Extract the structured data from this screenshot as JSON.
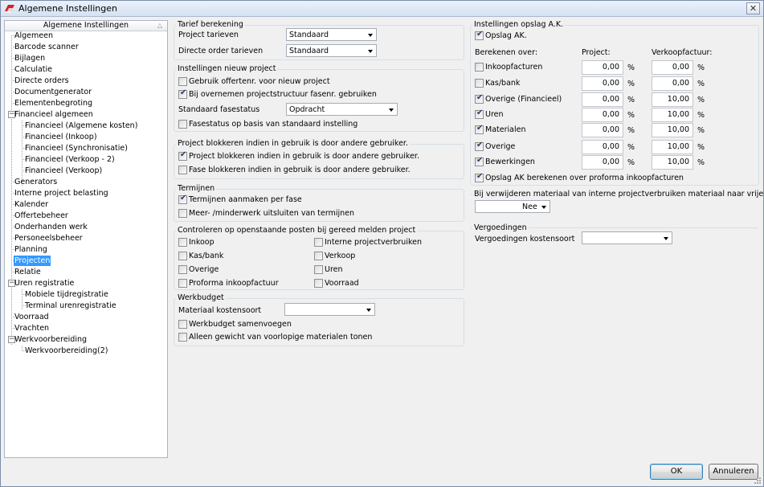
{
  "window": {
    "title": "Algemene Instellingen",
    "close_glyph": "✕",
    "app_icon": "brand-logo-icon"
  },
  "tree": {
    "header": "Algemene Instellingen",
    "sort_glyph": "△",
    "nodes": [
      {
        "label": "Algemeen"
      },
      {
        "label": "Barcode scanner"
      },
      {
        "label": "Bijlagen"
      },
      {
        "label": "Calculatie"
      },
      {
        "label": "Directe orders"
      },
      {
        "label": "Documentgenerator"
      },
      {
        "label": "Elementenbegroting"
      },
      {
        "label": "Financieel algemeen",
        "expander": "−"
      },
      {
        "label": "Financieel (Algemene kosten)"
      },
      {
        "label": "Financieel (Inkoop)"
      },
      {
        "label": "Financieel (Synchronisatie)"
      },
      {
        "label": "Financieel (Verkoop - 2)"
      },
      {
        "label": "Financieel (Verkoop)"
      },
      {
        "label": "Generators"
      },
      {
        "label": "Interne project belasting"
      },
      {
        "label": "Kalender"
      },
      {
        "label": "Offertebeheer"
      },
      {
        "label": "Onderhanden werk"
      },
      {
        "label": "Personeelsbeheer"
      },
      {
        "label": "Planning"
      },
      {
        "label": "Projecten",
        "selected": true
      },
      {
        "label": "Relatie"
      },
      {
        "label": "Uren registratie",
        "expander": "−"
      },
      {
        "label": "Mobiele tijdregistratie"
      },
      {
        "label": "Terminal urenregistratie"
      },
      {
        "label": "Voorraad"
      },
      {
        "label": "Vrachten"
      },
      {
        "label": "Werkvoorbereiding",
        "expander": "−"
      },
      {
        "label": "Werkvoorbereiding(2)"
      }
    ]
  },
  "tarief": {
    "title": "Tarief berekening",
    "project_label": "Project tarieven",
    "project_value": "Standaard",
    "directe_label": "Directe order tarieven",
    "directe_value": "Standaard"
  },
  "nieuw_project": {
    "title": "Instellingen nieuw project",
    "cb1_label": "Gebruik offertenr. voor nieuw project",
    "cb1_checked": false,
    "cb2_label": "Bij overnemen projectstructuur fasenr. gebruiken",
    "cb2_checked": true,
    "fase_label": "Standaard fasestatus",
    "fase_value": "Opdracht",
    "cb3_label": "Fasestatus op basis van standaard instelling",
    "cb3_checked": false
  },
  "blokkeren": {
    "title": "Project blokkeren indien in gebruik is door andere gebruiker.",
    "cb1_label": "Project blokkeren indien in gebruik is door andere gebruiker.",
    "cb1_checked": true,
    "cb2_label": "Fase blokkeren indien in gebruik is door andere gebruiker.",
    "cb2_checked": false
  },
  "termijnen": {
    "title": "Termijnen",
    "cb1_label": "Termijnen aanmaken per fase",
    "cb1_checked": true,
    "cb2_label": "Meer- /minderwerk uitsluiten van termijnen",
    "cb2_checked": false
  },
  "controleren": {
    "title": "Controleren op openstaande posten bij gereed melden project",
    "items": [
      {
        "label": "Inkoop",
        "checked": false
      },
      {
        "label": "Interne projectverbruiken",
        "checked": false
      },
      {
        "label": "Kas/bank",
        "checked": false
      },
      {
        "label": "Verkoop",
        "checked": false
      },
      {
        "label": "Overige",
        "checked": false
      },
      {
        "label": "Uren",
        "checked": false
      },
      {
        "label": "Proforma inkoopfactuur",
        "checked": false
      },
      {
        "label": "Voorraad",
        "checked": false
      }
    ]
  },
  "werkbudget": {
    "title": "Werkbudget",
    "kostensoort_label": "Materiaal kostensoort",
    "kostensoort_value": "",
    "cb1_label": "Werkbudget samenvoegen",
    "cb1_checked": false,
    "cb2_label": "Alleen gewicht van voorlopige materialen tonen",
    "cb2_checked": false
  },
  "opslag": {
    "title": "Instellingen opslag A.K.",
    "opslag_label": "Opslag AK.",
    "opslag_checked": true,
    "col_over": "Berekenen over:",
    "col_project": "Project:",
    "col_verkoop": "Verkoopfactuur:",
    "pct_symbol": "%",
    "rows": [
      {
        "label": "Inkoopfacturen",
        "checked": false,
        "project": "0,00",
        "verkoop": "0,00"
      },
      {
        "label": "Kas/bank",
        "checked": false,
        "project": "0,00",
        "verkoop": "0,00"
      },
      {
        "label": "Overige (Financieel)",
        "checked": true,
        "project": "0,00",
        "verkoop": "10,00"
      },
      {
        "label": "Uren",
        "checked": true,
        "project": "0,00",
        "verkoop": "10,00"
      },
      {
        "label": "Materialen",
        "checked": true,
        "project": "0,00",
        "verkoop": "10,00"
      },
      {
        "label": "Overige",
        "checked": true,
        "project": "0,00",
        "verkoop": "10,00"
      },
      {
        "label": "Bewerkingen",
        "checked": true,
        "project": "0,00",
        "verkoop": "10,00"
      }
    ],
    "proforma_label": "Opslag AK berekenen over proforma inkoopfacturen",
    "proforma_checked": true
  },
  "verwijderen": {
    "title": "Bij verwijderen materiaal van interne projectverbruiken materiaal naar vrije voorraad boeken",
    "value": "Nee"
  },
  "vergoedingen": {
    "title": "Vergoedingen",
    "label": "Vergoedingen kostensoort",
    "value": ""
  },
  "buttons": {
    "ok": "OK",
    "cancel": "Annuleren"
  }
}
